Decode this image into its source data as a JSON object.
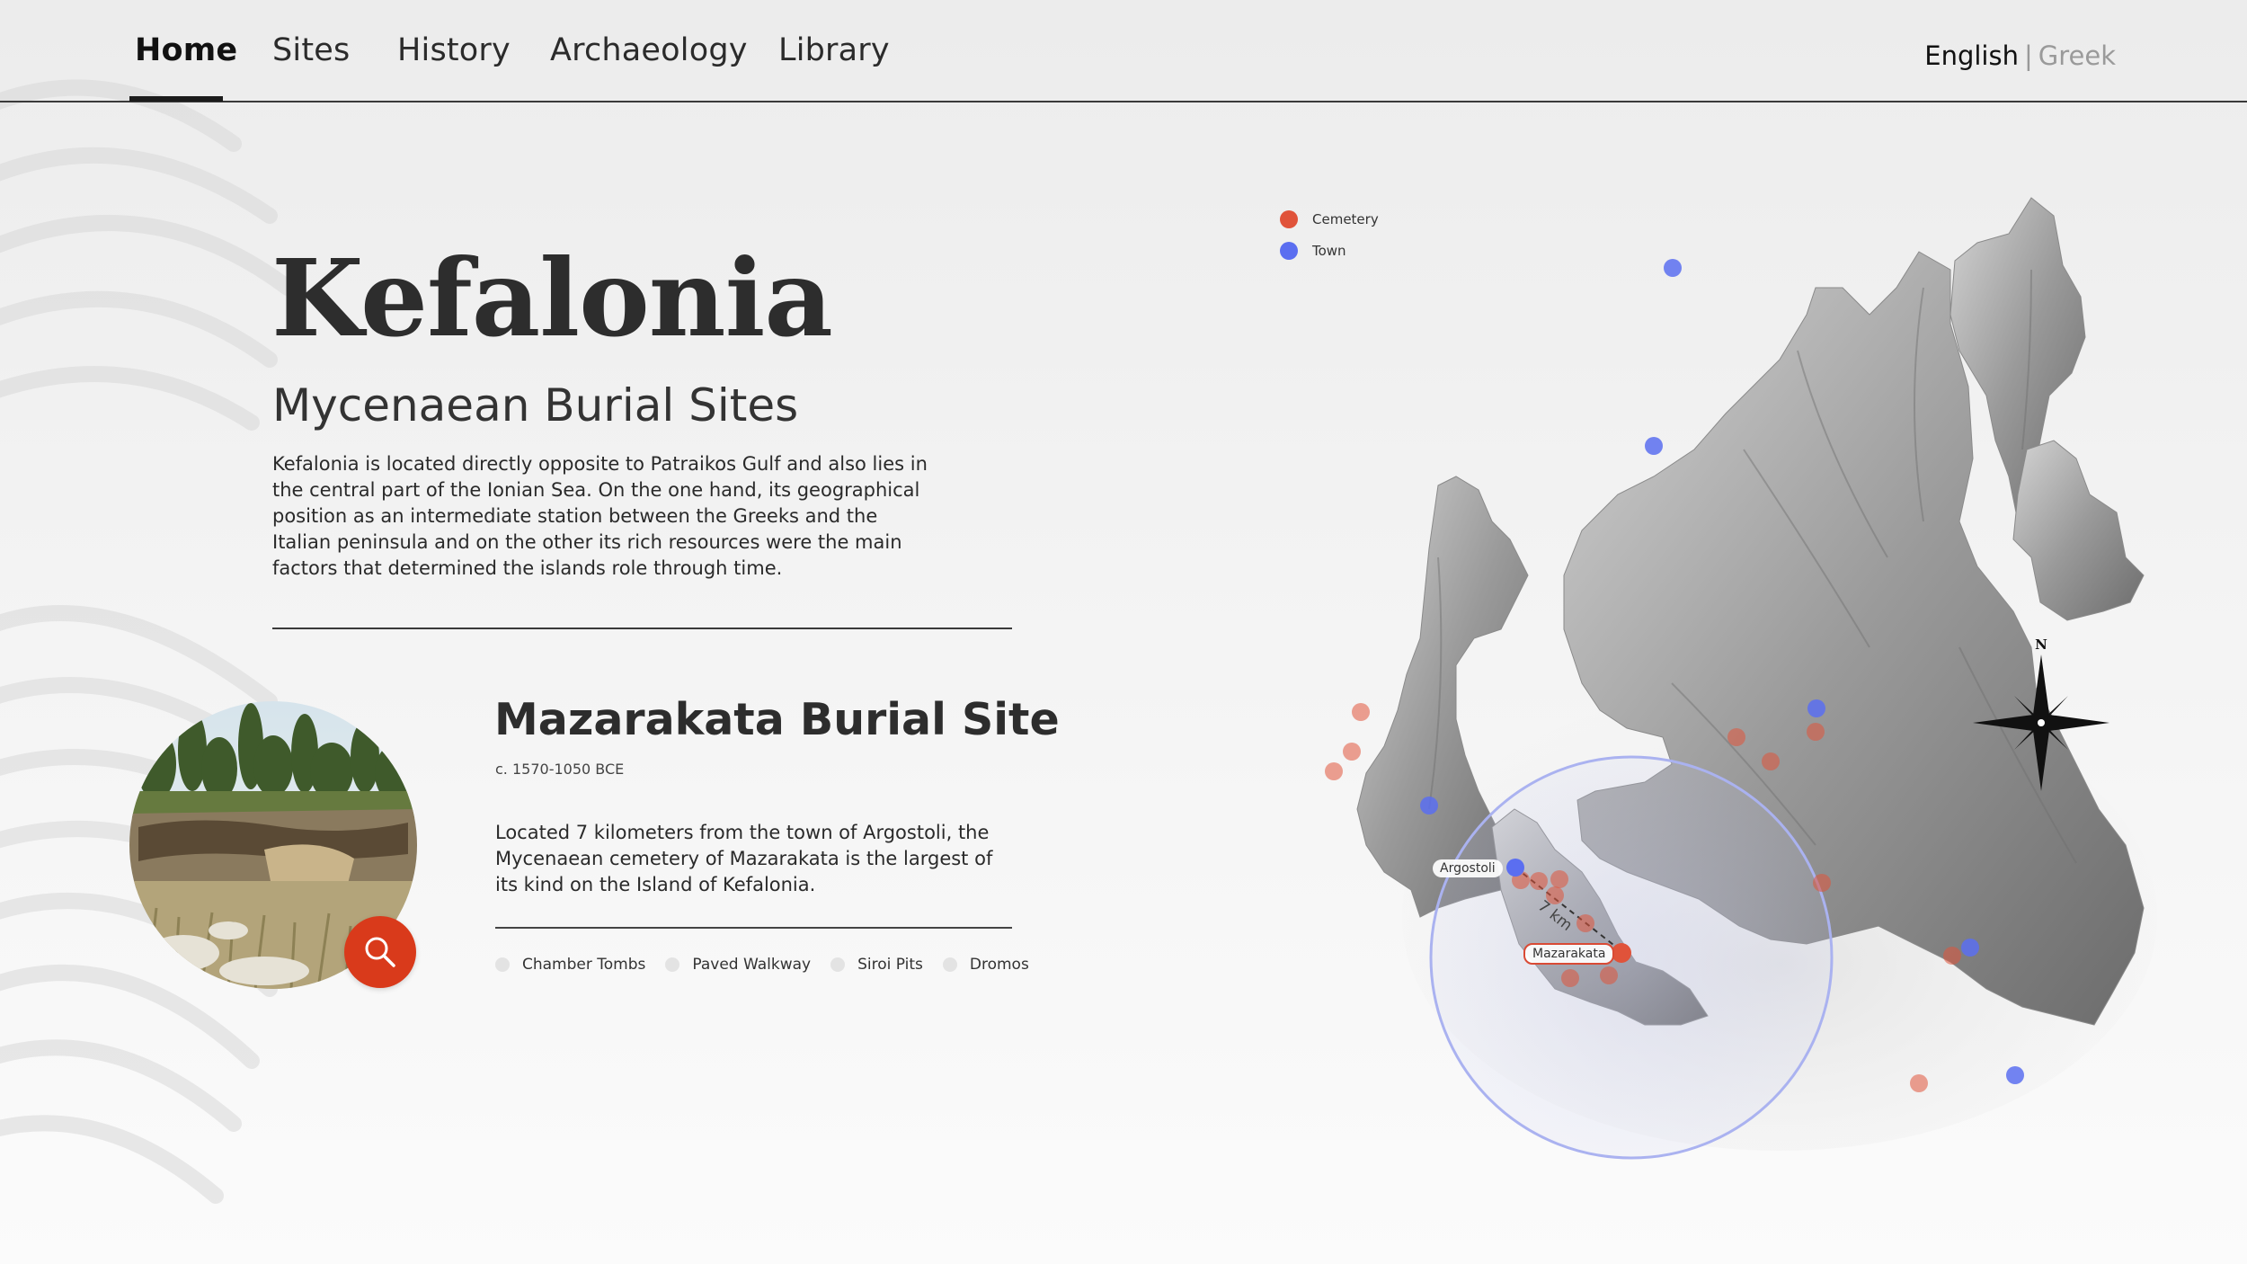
{
  "nav": {
    "items": [
      {
        "label": "Home",
        "active": true
      },
      {
        "label": "Sites",
        "active": false
      },
      {
        "label": "History",
        "active": false
      },
      {
        "label": "Archaeology",
        "active": false
      },
      {
        "label": "Library",
        "active": false
      }
    ],
    "language": {
      "current": "English",
      "separator": "|",
      "other": "Greek"
    }
  },
  "hero": {
    "title": "Kefalonia",
    "subtitle": "Mycenaean Burial Sites",
    "intro": "Kefalonia is located directly opposite to Patraikos Gulf and also lies in the central part of the Ionian Sea. On the one hand, its geographical position as an intermediate station between the Greeks and the Italian peninsula and on the other its rich resources were the main factors that determined the islands role through time."
  },
  "site": {
    "title": "Mazarakata Burial Site",
    "date": "c. 1570-1050 BCE",
    "description": "Located 7 kilometers from the town of Argostoli, the Mycenaean cemetery of Mazarakata is the largest of its kind on the Island of Kefalonia.",
    "features": [
      "Chamber Tombs",
      "Paved Walkway",
      "Siroi Pits",
      "Dromos"
    ],
    "photo_icon": "site-photo",
    "search_icon": "search-icon"
  },
  "map": {
    "legend": [
      {
        "label": "Cemetery",
        "color": "#e0533a"
      },
      {
        "label": "Town",
        "color": "#5b6ef0"
      }
    ],
    "labels": {
      "argostoli": "Argostoli",
      "mazarakata": "Mazarakata",
      "distance": "7 km"
    },
    "compass_letter": "N",
    "radius_color": "#b9c0f2"
  }
}
